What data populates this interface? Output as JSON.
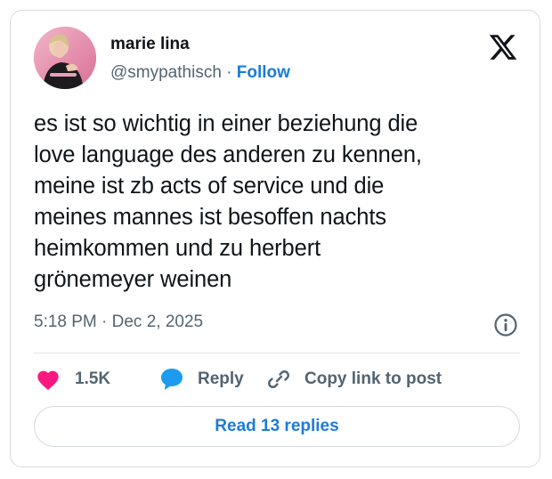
{
  "author": {
    "name": "marie lina",
    "handle": "@smypathisch",
    "separator": "·",
    "follow_label": "Follow"
  },
  "tweet": {
    "lines": [
      "es ist so wichtig in einer beziehung die",
      "love language des anderen zu kennen,",
      "meine ist zb acts of service und die",
      "meines mannes ist besoffen nachts",
      "heimkommen und zu herbert",
      "grönemeyer weinen"
    ],
    "timestamp": "5:18 PM · Dec 2, 2025"
  },
  "actions": {
    "likes": "1.5K",
    "reply_label": "Reply",
    "copy_label": "Copy link to post"
  },
  "footer": {
    "read_replies_label": "Read 13 replies"
  },
  "icons": {
    "brand": "x-logo-icon",
    "info": "info-icon",
    "like": "heart-icon",
    "reply": "speech-bubble-icon",
    "copy": "link-icon"
  },
  "colors": {
    "like": "#f91880",
    "reply": "#1d9bf0",
    "link": "#1d7bd8",
    "text": "#0f1419",
    "muted": "#536471"
  }
}
